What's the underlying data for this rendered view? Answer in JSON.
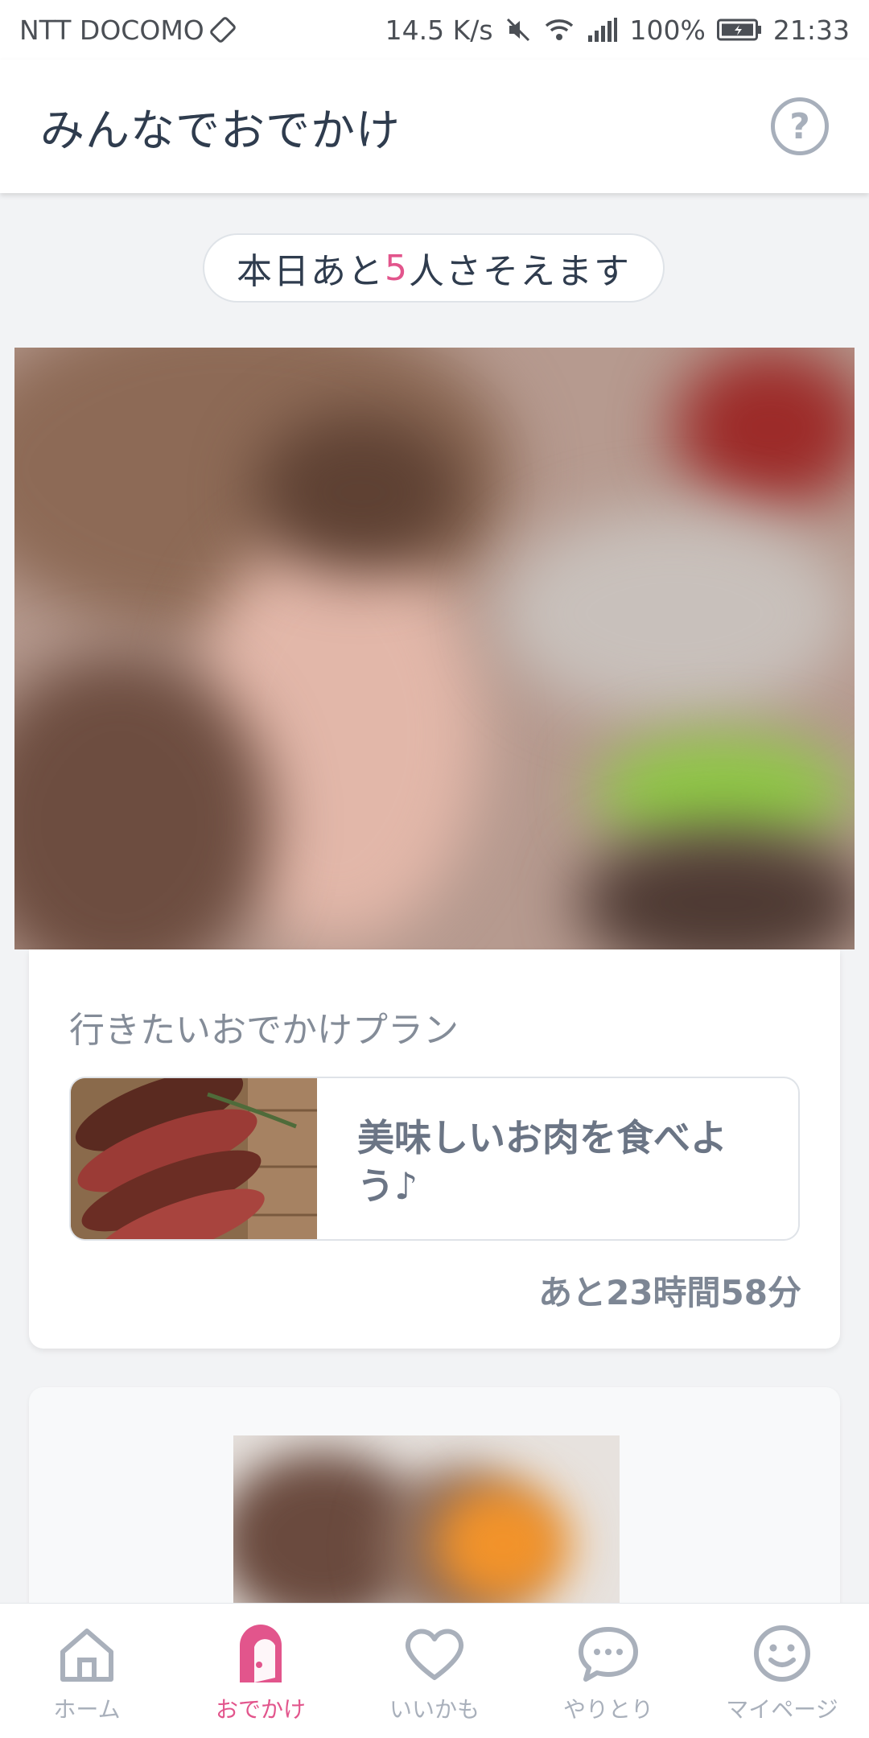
{
  "status_bar": {
    "carrier": "NTT DOCOMO",
    "network_speed": "14.5 K/s",
    "battery": "100%",
    "time": "21:33"
  },
  "header": {
    "title": "みんなでおでかけ",
    "help_glyph": "?"
  },
  "remaining": {
    "prefix": "本日あと",
    "count": "5",
    "suffix": "人さそえます"
  },
  "plan_card": {
    "section_label": "行きたいおでかけプラン",
    "plan_title": "美味しいお肉を食べよう♪",
    "time_left": "あと23時間58分"
  },
  "bottom_nav": {
    "items": [
      {
        "label": "ホーム",
        "icon": "home-icon"
      },
      {
        "label": "おでかけ",
        "icon": "door-icon"
      },
      {
        "label": "いいかも",
        "icon": "heart-icon"
      },
      {
        "label": "やりとり",
        "icon": "chat-bubble-icon"
      },
      {
        "label": "マイページ",
        "icon": "smiley-icon"
      }
    ],
    "active_index": 1
  },
  "colors": {
    "accent_pink": "#e2558c",
    "text_dark": "#2f3c4e",
    "text_muted": "#848c98",
    "background": "#f2f3f5"
  }
}
